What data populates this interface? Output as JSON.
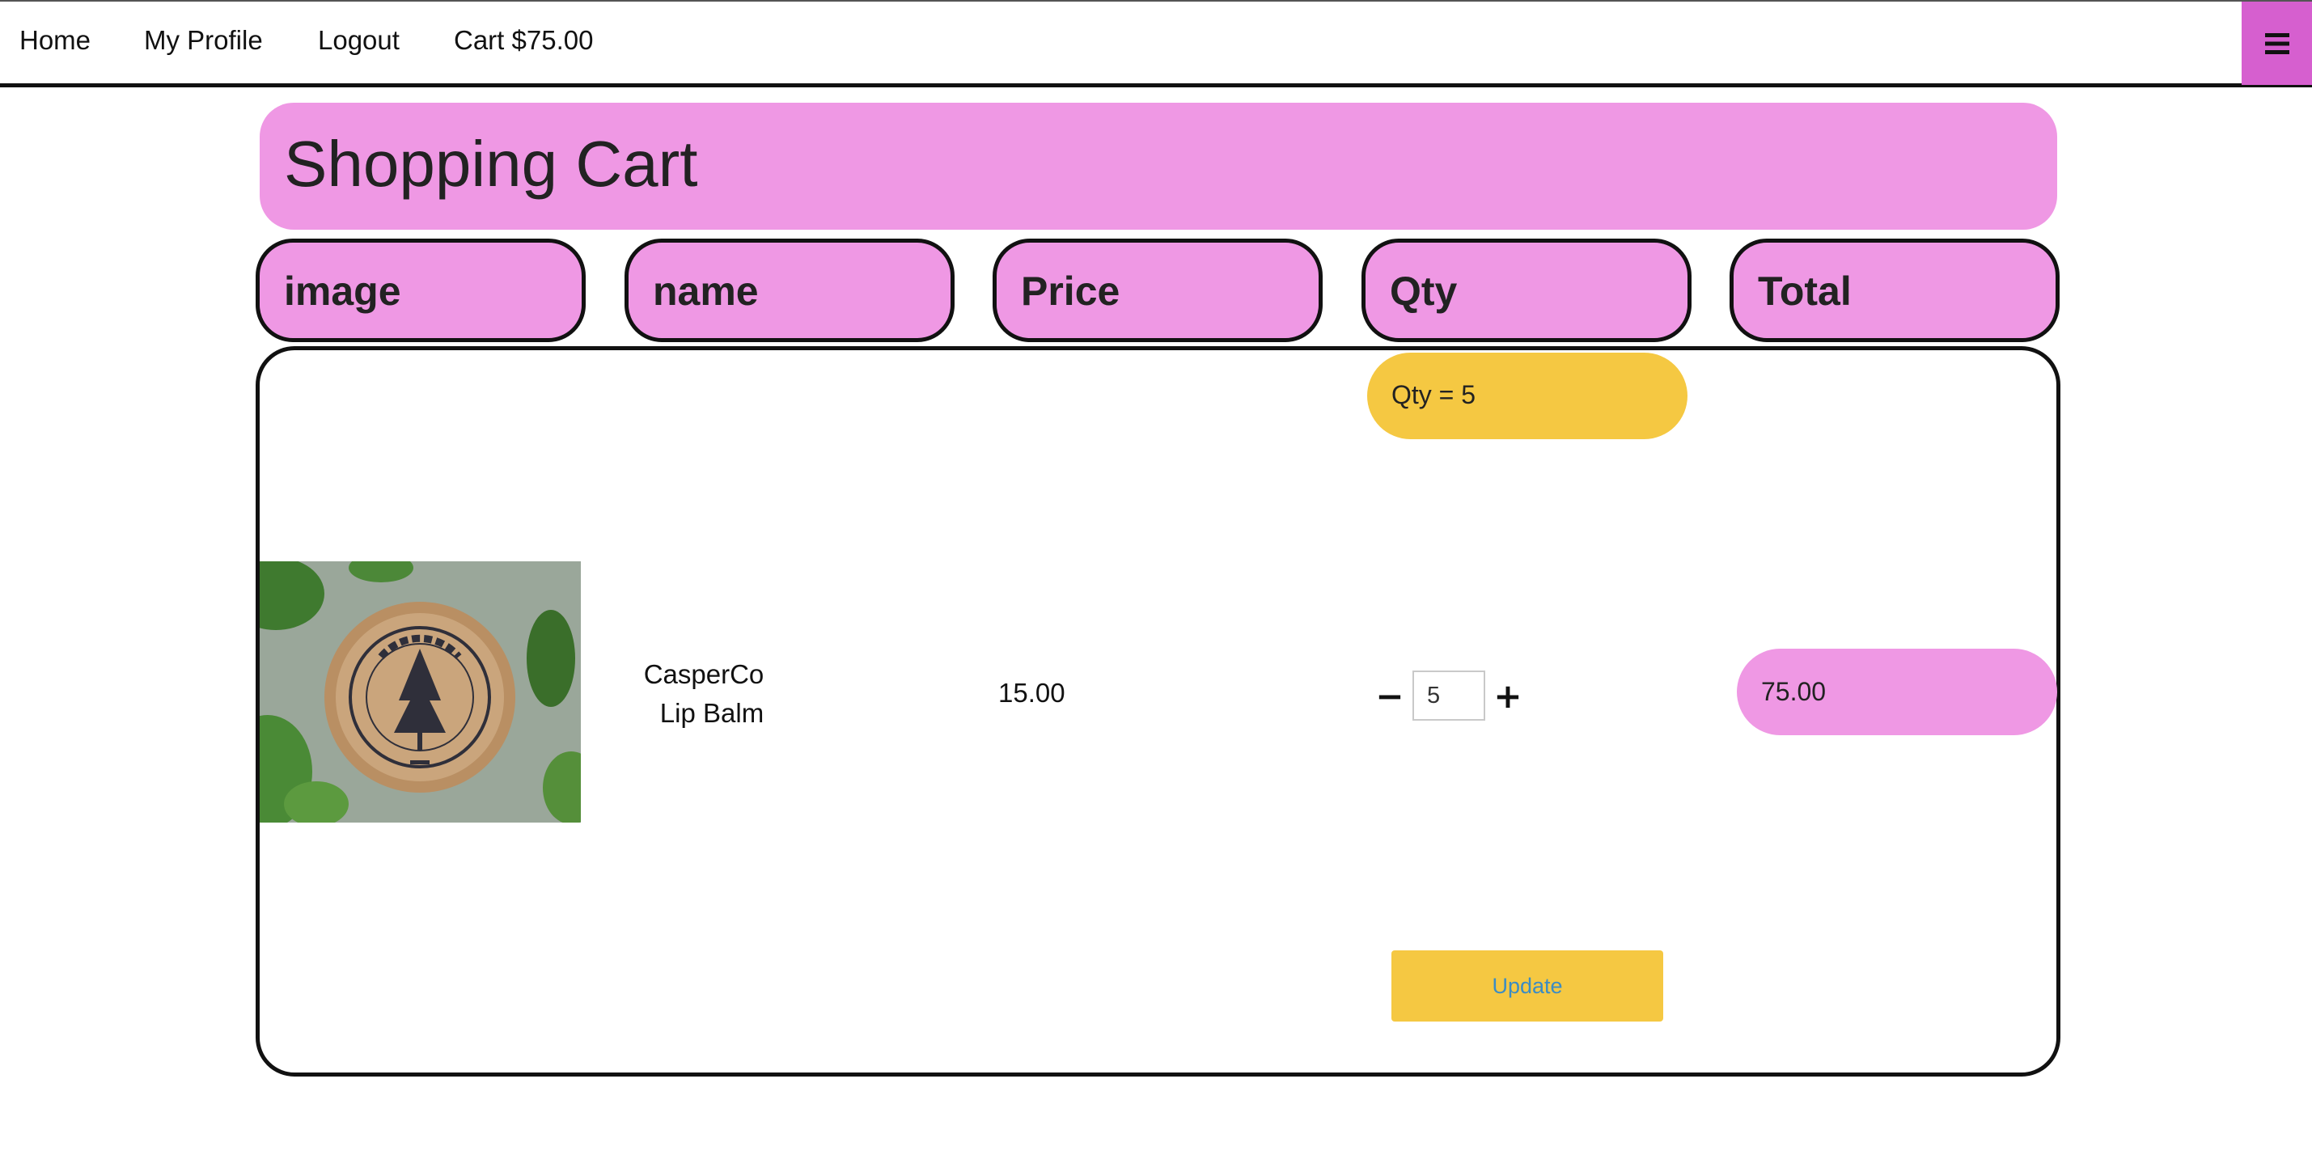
{
  "nav": {
    "links": [
      "Home",
      "My Profile",
      "Logout",
      "Cart $75.00"
    ],
    "menu_icon": "hamburger-icon"
  },
  "page": {
    "title": "Shopping Cart"
  },
  "table": {
    "headers": [
      "image",
      "name",
      "Price",
      "Qty",
      "Total"
    ],
    "rows": [
      {
        "image": "product-photo",
        "name_line1": "CasperCo",
        "name_line2": "Lip Balm",
        "price": "15.00",
        "qty_badge": "Qty = 5",
        "qty_value": "5",
        "minus_label": "−",
        "plus_label": "+",
        "total": "75.00",
        "update_label": "Update"
      }
    ]
  },
  "colors": {
    "pink": "#ef98e4",
    "menu_pink": "#d65fcf",
    "yellow": "#f5c842",
    "update_text": "#3b8cc4"
  }
}
